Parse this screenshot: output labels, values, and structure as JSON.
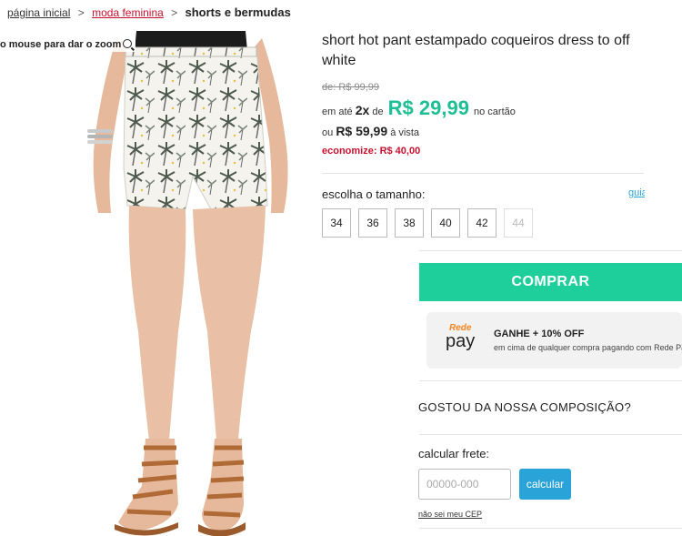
{
  "breadcrumb": {
    "home": "página inicial",
    "category": "moda feminina",
    "separator": ">",
    "current": "shorts e bermudas"
  },
  "gallery": {
    "zoom_hint": "o mouse para dar o zoom"
  },
  "product": {
    "title": "short hot pant estampado coqueiros dress to off white",
    "old_price": "de: R$ 99,99",
    "installments_prefix": "em até",
    "installments_count": "2x",
    "installments_de": "de",
    "installment_value": "R$ 29,99",
    "installments_suffix": "no cartão",
    "cash_prefix": "ou",
    "cash_value": "R$ 59,99",
    "cash_suffix": "à vista",
    "savings": "economize: R$ 40,00"
  },
  "sizes": {
    "label": "escolha o tamanho:",
    "guide_link": "guia",
    "options": [
      {
        "label": "34",
        "available": true
      },
      {
        "label": "36",
        "available": true
      },
      {
        "label": "38",
        "available": true
      },
      {
        "label": "40",
        "available": true
      },
      {
        "label": "42",
        "available": true
      },
      {
        "label": "44",
        "available": false
      }
    ]
  },
  "buy_button": "COMPRAR",
  "promo": {
    "logo_top": "Rede",
    "logo_bottom": "pay",
    "title": "GANHE + 10% OFF",
    "subtitle": "em cima de qualquer compra pagando com Rede Pay!*"
  },
  "composition_heading": "GOSTOU DA NOSSA COMPOSIÇÃO?",
  "freight": {
    "label": "calcular frete:",
    "placeholder": "00000-000",
    "button": "calcular",
    "no_zip_link": "não sei meu CEP"
  },
  "colors": {
    "accent_green": "#1fcf9b",
    "price_green": "#1fbf95",
    "link_blue": "#2aa3d8",
    "sale_red": "#c8102e",
    "redepay_orange": "#f5861f"
  }
}
